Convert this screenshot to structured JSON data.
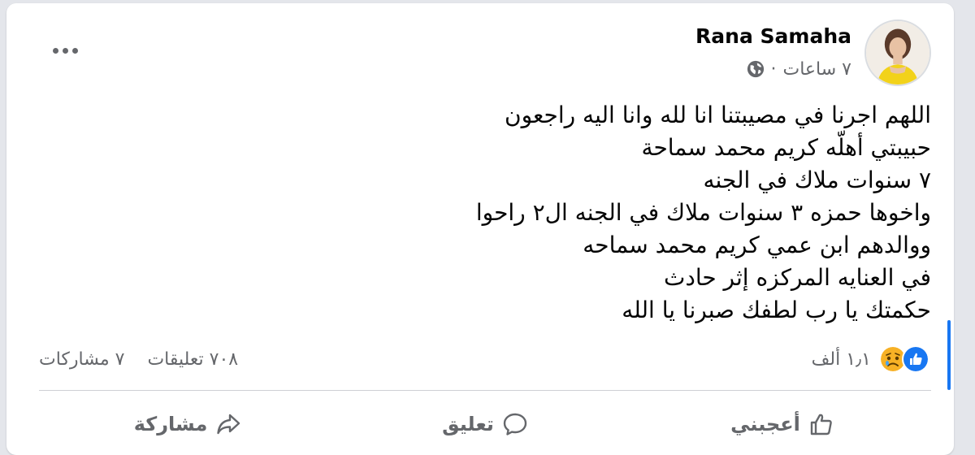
{
  "post": {
    "author": "Rana Samaha",
    "time": "٧ ساعات",
    "separator": "·",
    "privacy_icon": "globe-icon",
    "lines": [
      "اللهم اجرنا في مصيبتنا انا لله وانا اليه راجعون",
      "حبيبتي أهلّه كريم محمد سماحة",
      "٧ سنوات ملاك في الجنه",
      "واخوها حمزه ٣ سنوات ملاك في الجنه ال٢ راحوا",
      "ووالدهم ابن عمي كريم محمد سماحه",
      "في العنايه المركزه إثر حادث",
      "حكمتك يا رب لطفك صبرنا يا الله"
    ]
  },
  "stats": {
    "reactions_count": "١٫١ ألف",
    "reaction_icons": [
      "like-icon",
      "sad-icon"
    ],
    "comments": "٧٠٨ تعليقات",
    "shares": "٧ مشاركات"
  },
  "actions": {
    "like": "أعجبني",
    "comment": "تعليق",
    "share": "مشاركة"
  },
  "colors": {
    "accent": "#1877f2",
    "muted_text": "#65676b",
    "sad_reaction": "#f7b125"
  }
}
